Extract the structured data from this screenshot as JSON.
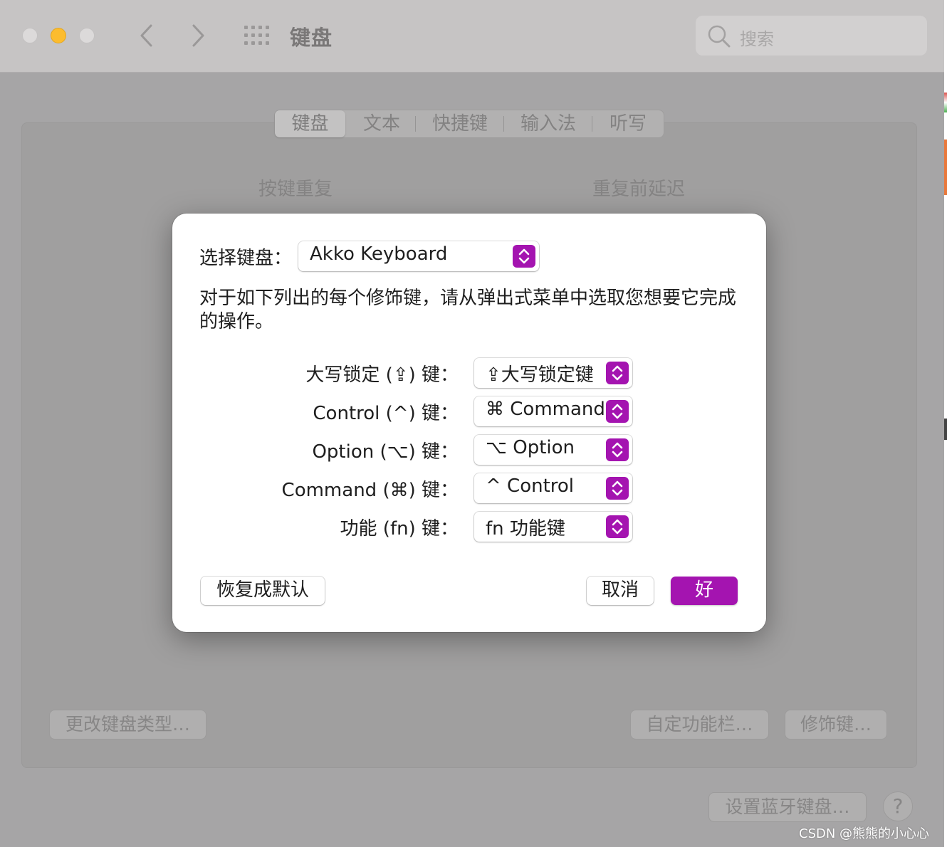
{
  "window": {
    "title": "键盘",
    "search_placeholder": "搜索"
  },
  "tabs": [
    {
      "label": "键盘",
      "active": true
    },
    {
      "label": "文本",
      "active": false
    },
    {
      "label": "快捷键",
      "active": false
    },
    {
      "label": "输入法",
      "active": false
    },
    {
      "label": "听写",
      "active": false
    }
  ],
  "sections": {
    "key_repeat": "按键重复",
    "delay_until_repeat": "重复前延迟"
  },
  "background_buttons": {
    "change_keyboard_type": "更改键盘类型…",
    "customize_control_strip": "自定功能栏…",
    "modifier_keys": "修饰键…",
    "setup_bluetooth_keyboard": "设置蓝牙键盘…",
    "help": "?"
  },
  "dialog": {
    "select_keyboard_label": "选择键盘：",
    "selected_keyboard": "Akko Keyboard",
    "description": "对于如下列出的每个修饰键，请从弹出式菜单中选取您想要它完成的操作。",
    "modifiers": [
      {
        "label": "大写锁定 (⇪) 键：",
        "value": "⇪大写锁定键"
      },
      {
        "label": "Control (^) 键：",
        "value": "⌘ Command"
      },
      {
        "label": "Option (⌥) 键：",
        "value": "⌥ Option"
      },
      {
        "label": "Command (⌘) 键：",
        "value": "^ Control"
      },
      {
        "label": "功能 (fn) 键：",
        "value": "fn 功能键"
      }
    ],
    "restore_defaults": "恢复成默认",
    "cancel": "取消",
    "ok": "好"
  },
  "watermark": "CSDN @熊熊的小心心",
  "colors": {
    "accent": "#a414b0",
    "minimize": "#fcbc2e"
  }
}
